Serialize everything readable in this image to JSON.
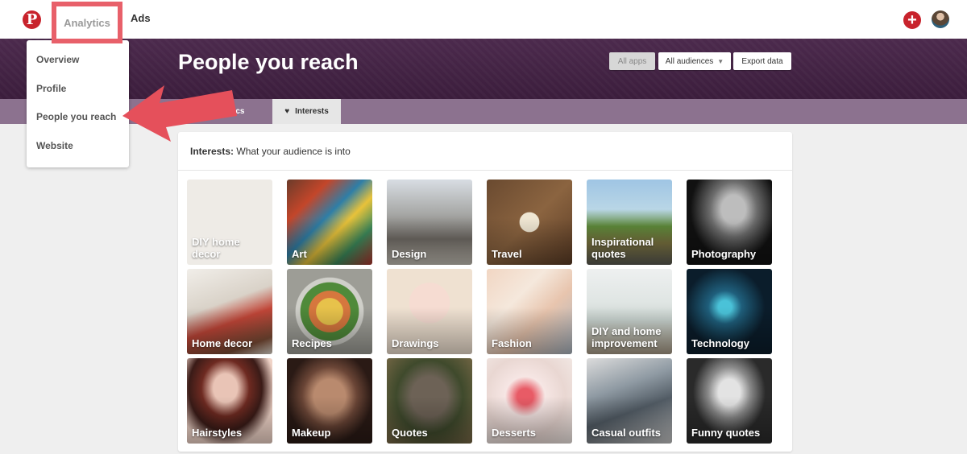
{
  "topbar": {
    "logo_glyph": "P",
    "analytics_label": "Analytics",
    "ads_label": "Ads",
    "plus_glyph": "+"
  },
  "dropdown": {
    "items": [
      {
        "label": "Overview"
      },
      {
        "label": "Profile"
      },
      {
        "label": "People you reach"
      },
      {
        "label": "Website"
      }
    ]
  },
  "header": {
    "title": "People you reach",
    "buttons": {
      "all_apps": "All apps",
      "all_audiences": "All audiences",
      "export_data": "Export data"
    }
  },
  "tabs": {
    "demographics": "Demographics",
    "interests": "Interests"
  },
  "card": {
    "heading_bold": "Interests:",
    "heading_text": " What your audience is into",
    "tiles": [
      {
        "label": "DIY home decor"
      },
      {
        "label": "Art"
      },
      {
        "label": "Design"
      },
      {
        "label": "Travel"
      },
      {
        "label": "Inspirational quotes"
      },
      {
        "label": "Photography"
      },
      {
        "label": "Home decor"
      },
      {
        "label": "Recipes"
      },
      {
        "label": "Drawings"
      },
      {
        "label": "Fashion"
      },
      {
        "label": "DIY and home improvement"
      },
      {
        "label": "Technology"
      },
      {
        "label": "Hairstyles"
      },
      {
        "label": "Makeup"
      },
      {
        "label": "Quotes"
      },
      {
        "label": "Desserts"
      },
      {
        "label": "Casual outfits"
      },
      {
        "label": "Funny quotes"
      }
    ]
  },
  "colors": {
    "brand_red": "#c8232c",
    "highlight": "#e8606a",
    "header_purple": "#3b1d3c",
    "subnav_purple": "#8c728f"
  }
}
